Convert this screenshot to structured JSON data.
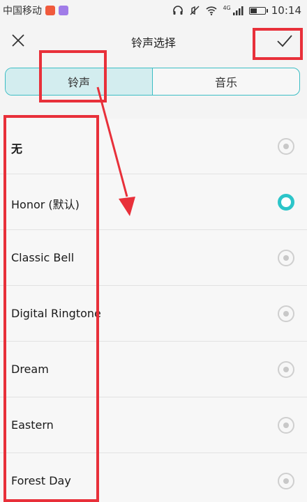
{
  "status_bar": {
    "carrier": "中国移动",
    "network": "4G",
    "time": "10:14",
    "battery_level": 0.4
  },
  "header": {
    "title": "铃声选择",
    "close_icon": "close-icon",
    "confirm_icon": "checkmark-icon"
  },
  "tabs": [
    {
      "label": "铃声",
      "active": true
    },
    {
      "label": "音乐",
      "active": false
    }
  ],
  "ringtones": [
    {
      "label": "无",
      "selected": false
    },
    {
      "label": "Honor (默认)",
      "selected": true
    },
    {
      "label": "Classic Bell",
      "selected": false
    },
    {
      "label": "Digital Ringtone",
      "selected": false
    },
    {
      "label": "Dream",
      "selected": false
    },
    {
      "label": "Eastern",
      "selected": false
    },
    {
      "label": "Forest Day",
      "selected": false
    }
  ],
  "colors": {
    "accent": "#2cc5c9",
    "annotation": "#e8303a"
  }
}
